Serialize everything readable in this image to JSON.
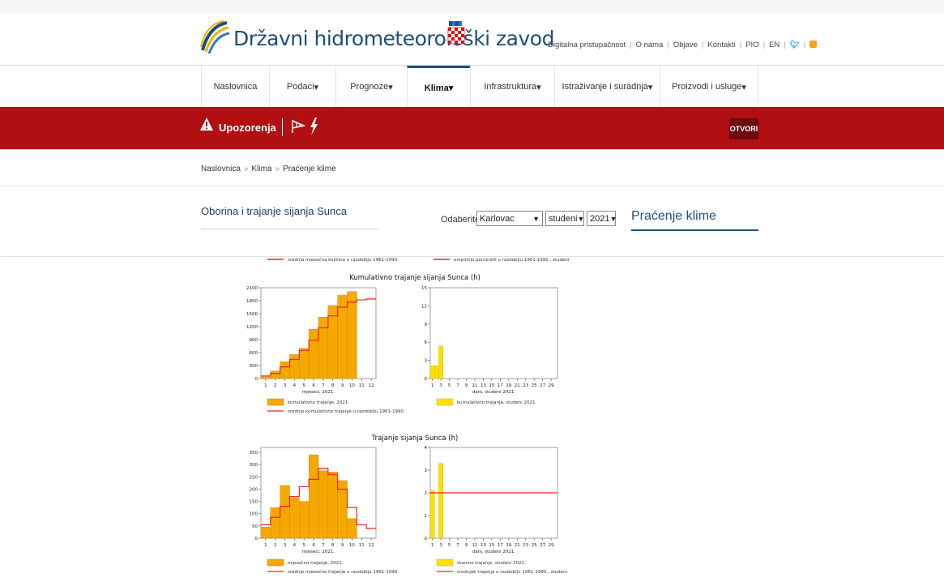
{
  "header": {
    "site_title": "Državni hidrometeorološki zavod",
    "top_links": [
      "Digitalna pristupačnost",
      "O nama",
      "Objave",
      "Kontakti",
      "PIO",
      "EN"
    ]
  },
  "nav": {
    "items": [
      {
        "label": "Naslovnica",
        "caret": ""
      },
      {
        "label": "Podaci",
        "caret": " ▾"
      },
      {
        "label": "Prognoze",
        "caret": " ▾"
      },
      {
        "label": "Klima",
        "caret": " ▾"
      },
      {
        "label": "Infrastruktura",
        "caret": " ▾"
      },
      {
        "label": "Istraživanje i suradnja",
        "caret": " ▾"
      },
      {
        "label": "Proizvodi i usluge",
        "caret": " ▾"
      }
    ]
  },
  "warnings": {
    "title": "Upozorenja",
    "button": "OTVORI"
  },
  "breadcrumb": [
    "Naslovnica",
    "Klima",
    "Praćenje klime"
  ],
  "section": {
    "title": "Oborina i trajanje sijanja Sunca",
    "choose_label": "Odaberite",
    "station": "Karlovac",
    "month": "studeni",
    "year": "2021"
  },
  "sidebar": {
    "title": "Praćenje klime"
  },
  "clipped_legend": {
    "left": "srednja mjesečna količina u razdoblju 1961-1990.",
    "right": "empirički percentili u razdoblju 1961-1990., studeni"
  },
  "colors": {
    "nav_active": "#1f4e79",
    "warn_bar": "#b10f12",
    "bar_orange": "#f5a800",
    "bar_yellow": "#ffe000",
    "ref_line": "#ee2222"
  },
  "chart_data": [
    {
      "type": "bar",
      "title": "Kumulativno trajanje sijanja Sunca (h)",
      "xlabel": "mjeseci, 2021.",
      "x": [
        1,
        2,
        3,
        4,
        5,
        6,
        7,
        8,
        9,
        10,
        11,
        12
      ],
      "series": [
        {
          "name": "kumulativno trajanje, 2021.",
          "values": [
            45,
            175,
            390,
            555,
            700,
            1140,
            1420,
            1690,
            1930,
            2010,
            null,
            null
          ]
        },
        {
          "name": "srednje kumulativno trajanje u razdoblju 1961-1990.",
          "values": [
            60,
            120,
            270,
            440,
            650,
            885,
            1175,
            1450,
            1650,
            1770,
            1820,
            1840
          ]
        }
      ],
      "ylim": [
        0,
        2100
      ],
      "yticks": [
        0,
        300,
        600,
        900,
        1200,
        1500,
        1800,
        2100
      ],
      "xticks": [
        1,
        2,
        3,
        4,
        5,
        6,
        7,
        8,
        9,
        10,
        11,
        12
      ]
    },
    {
      "type": "bar",
      "xlabel": "dani, studeni 2021.",
      "x": [
        1,
        2,
        3,
        4,
        5,
        6,
        7,
        8,
        9,
        10,
        11,
        12,
        13,
        14,
        15,
        16,
        17,
        18,
        19,
        20,
        21,
        22,
        23,
        24,
        25,
        26,
        27,
        28,
        29,
        30
      ],
      "series": [
        {
          "name": "kumulativno trajanje, studeni 2021.",
          "values": [
            2.1,
            2.1,
            5.4,
            null,
            null,
            null,
            null,
            null,
            null,
            null,
            null,
            null,
            null,
            null,
            null,
            null,
            null,
            null,
            null,
            null,
            null,
            null,
            null,
            null,
            null,
            null,
            null,
            null,
            null,
            null
          ]
        }
      ],
      "ylim": [
        0,
        15
      ],
      "yticks": [
        0,
        3,
        6,
        9,
        12,
        15
      ],
      "xticks": [
        1,
        3,
        5,
        7,
        9,
        11,
        13,
        15,
        17,
        19,
        21,
        23,
        25,
        27,
        29
      ]
    },
    {
      "type": "bar",
      "title": "Trajanje sijanja Sunca (h)",
      "xlabel": "mjeseci, 2021.",
      "x": [
        1,
        2,
        3,
        4,
        5,
        6,
        7,
        8,
        9,
        10,
        11,
        12
      ],
      "series": [
        {
          "name": "mjesečno trajanje, 2021.",
          "values": [
            45,
            125,
            215,
            165,
            150,
            340,
            275,
            270,
            235,
            80,
            null,
            null
          ]
        },
        {
          "name": "srednje mjesečno trajanje u razdoblju 1961-1990.",
          "values": [
            55,
            85,
            130,
            170,
            210,
            240,
            285,
            260,
            200,
            125,
            55,
            40
          ]
        }
      ],
      "ylim": [
        0,
        370
      ],
      "yticks": [
        0,
        50,
        100,
        150,
        200,
        250,
        300,
        350
      ],
      "xticks": [
        1,
        2,
        3,
        4,
        5,
        6,
        7,
        8,
        9,
        10,
        11,
        12
      ]
    },
    {
      "type": "bar",
      "xlabel": "dani, studeni 2021.",
      "x": [
        1,
        2,
        3,
        4,
        5,
        6,
        7,
        8,
        9,
        10,
        11,
        12,
        13,
        14,
        15,
        16,
        17,
        18,
        19,
        20,
        21,
        22,
        23,
        24,
        25,
        26,
        27,
        28,
        29,
        30
      ],
      "series": [
        {
          "name": "dnevno trajanje, studeni 2021.",
          "values": [
            2.1,
            0,
            3.3,
            null,
            null,
            null,
            null,
            null,
            null,
            null,
            null,
            null,
            null,
            null,
            null,
            null,
            null,
            null,
            null,
            null,
            null,
            null,
            null,
            null,
            null,
            null,
            null,
            null,
            null,
            null
          ]
        },
        {
          "name": "srednjak trajanja u razdoblju 1961-1990., studeni",
          "values": [
            2,
            2,
            2,
            2,
            2,
            2,
            2,
            2,
            2,
            2,
            2,
            2,
            2,
            2,
            2,
            2,
            2,
            2,
            2,
            2,
            2,
            2,
            2,
            2,
            2,
            2,
            2,
            2,
            2,
            2
          ]
        }
      ],
      "ylim": [
        0,
        4
      ],
      "yticks": [
        0,
        1,
        2,
        3,
        4
      ],
      "xticks": [
        1,
        3,
        5,
        7,
        9,
        11,
        13,
        15,
        17,
        19,
        21,
        23,
        25,
        27,
        29
      ]
    }
  ]
}
